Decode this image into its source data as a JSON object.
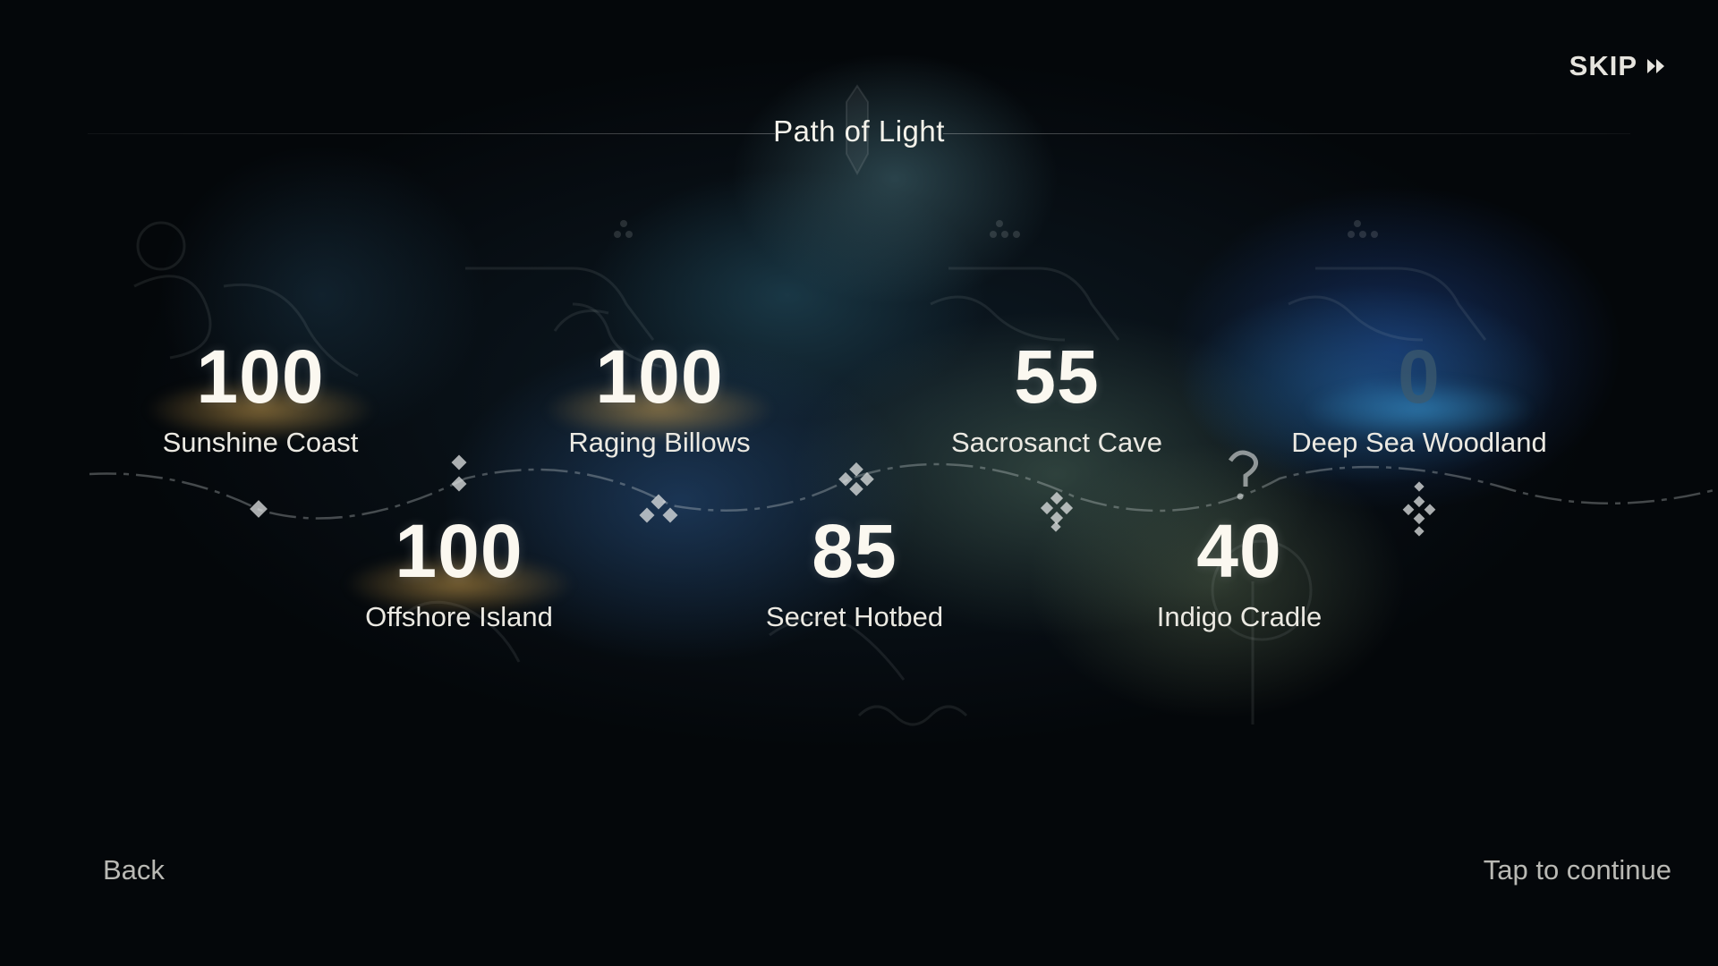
{
  "header": {
    "title": "Path of Light",
    "skip_label": "SKIP",
    "skip_icon": "fast-forward-icon"
  },
  "areas": [
    {
      "name": "Sunshine Coast",
      "value": "100",
      "glow": "gold"
    },
    {
      "name": "Raging Billows",
      "value": "100",
      "glow": "gold"
    },
    {
      "name": "Sacrosanct Cave",
      "value": "55",
      "glow": "none"
    },
    {
      "name": "Deep Sea Woodland",
      "value": "0",
      "glow": "blue"
    },
    {
      "name": "Offshore Island",
      "value": "100",
      "glow": "gold"
    },
    {
      "name": "Secret Hotbed",
      "value": "85",
      "glow": "none"
    },
    {
      "name": "Indigo Cradle",
      "value": "40",
      "glow": "none"
    }
  ],
  "footer": {
    "back_label": "Back",
    "continue_label": "Tap to continue"
  },
  "colors": {
    "background": "#04070a",
    "text": "#ebe9e2",
    "gold_glow": "#dcaa50",
    "blue_glow": "#3ca0dc"
  }
}
